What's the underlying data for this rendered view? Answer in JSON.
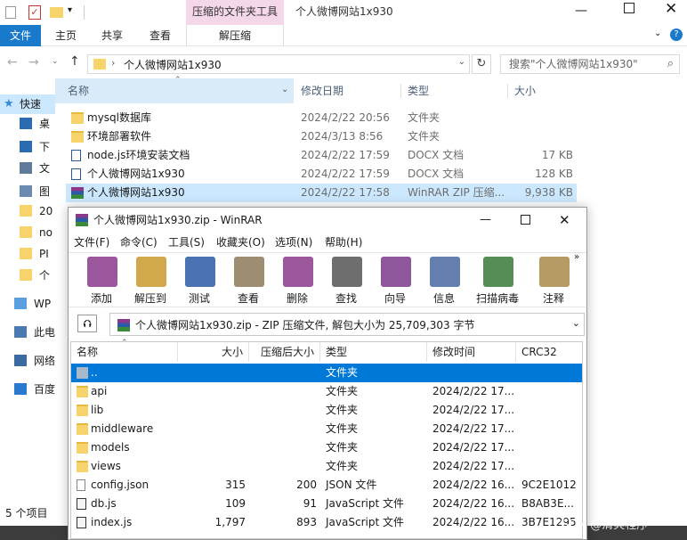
{
  "explorer": {
    "context_tab": "压缩的文件夹工具",
    "window_title": "个人微博网站1x930",
    "ribbon_tabs": [
      "文件",
      "主页",
      "共享",
      "查看",
      "解压缩"
    ],
    "address": "个人微博网站1x930",
    "search_placeholder": "搜索\"个人微博网站1x930\"",
    "columns": [
      "名称",
      "修改日期",
      "类型",
      "大小"
    ],
    "files": [
      {
        "name": "mysql数据库",
        "date": "2024/2/22 20:56",
        "type": "文件夹",
        "size": "",
        "icon": "folder-icon"
      },
      {
        "name": "环境部署软件",
        "date": "2024/3/13 8:56",
        "type": "文件夹",
        "size": "",
        "icon": "folder-icon"
      },
      {
        "name": "node.js环境安装文档",
        "date": "2024/2/22 17:59",
        "type": "DOCX 文档",
        "size": "17 KB",
        "icon": "docx-icon"
      },
      {
        "name": "个人微博网站1x930",
        "date": "2024/2/22 17:59",
        "type": "DOCX 文档",
        "size": "128 KB",
        "icon": "docx-icon"
      },
      {
        "name": "个人微博网站1x930",
        "date": "2024/2/22 17:58",
        "type": "WinRAR ZIP 压缩...",
        "size": "9,938 KB",
        "icon": "winrar-icon"
      }
    ],
    "sidebar": [
      {
        "label": "快速",
        "icon": "star-icon"
      },
      {
        "label": "桌",
        "icon": "desktop-icon"
      },
      {
        "label": "下",
        "icon": "download-icon"
      },
      {
        "label": "文",
        "icon": "document-icon"
      },
      {
        "label": "图",
        "icon": "picture-icon"
      },
      {
        "label": "20",
        "icon": "folder-icon"
      },
      {
        "label": "no",
        "icon": "folder-icon"
      },
      {
        "label": "PI",
        "icon": "folder-icon"
      },
      {
        "label": "个",
        "icon": "folder-icon"
      },
      {
        "label": "WP",
        "icon": "cloud-icon"
      },
      {
        "label": "此电",
        "icon": "pc-icon"
      },
      {
        "label": "网络",
        "icon": "network-icon"
      },
      {
        "label": "百度",
        "icon": "baidu-icon"
      }
    ],
    "status": "5 个项目"
  },
  "winrar": {
    "title": "个人微博网站1x930.zip - WinRAR",
    "menu": [
      "文件(F)",
      "命令(C)",
      "工具(S)",
      "收藏夹(O)",
      "选项(N)",
      "帮助(H)"
    ],
    "tools": [
      {
        "label": "添加",
        "icon": "add-archive-icon",
        "color": "#8b3a8b"
      },
      {
        "label": "解压到",
        "icon": "extract-icon",
        "color": "#c99a2e"
      },
      {
        "label": "测试",
        "icon": "test-icon",
        "color": "#2b5aa6"
      },
      {
        "label": "查看",
        "icon": "view-icon",
        "color": "#8a7a5a"
      },
      {
        "label": "删除",
        "icon": "delete-icon",
        "color": "#8b3a8b"
      },
      {
        "label": "查找",
        "icon": "find-icon",
        "color": "#555555"
      },
      {
        "label": "向导",
        "icon": "wizard-icon",
        "color": "#7a3a8b"
      },
      {
        "label": "信息",
        "icon": "info-icon",
        "color": "#4a6aa0"
      },
      {
        "label": "扫描病毒",
        "icon": "virus-scan-icon",
        "color": "#3a7a3a"
      },
      {
        "label": "注释",
        "icon": "comment-icon",
        "color": "#aa8a4a"
      }
    ],
    "path": "个人微博网站1x930.zip - ZIP 压缩文件, 解包大小为 25,709,303 字节",
    "columns": [
      "名称",
      "大小",
      "压缩后大小",
      "类型",
      "修改时间",
      "CRC32"
    ],
    "rows": [
      {
        "name": "..",
        "size": "",
        "packed": "",
        "type": "文件夹",
        "mtime": "",
        "crc": "",
        "icon": "up-folder-icon",
        "selected": true
      },
      {
        "name": "api",
        "size": "",
        "packed": "",
        "type": "文件夹",
        "mtime": "2024/2/22 17...",
        "crc": "",
        "icon": "folder-icon"
      },
      {
        "name": "lib",
        "size": "",
        "packed": "",
        "type": "文件夹",
        "mtime": "2024/2/22 17...",
        "crc": "",
        "icon": "folder-icon"
      },
      {
        "name": "middleware",
        "size": "",
        "packed": "",
        "type": "文件夹",
        "mtime": "2024/2/22 17...",
        "crc": "",
        "icon": "folder-icon"
      },
      {
        "name": "models",
        "size": "",
        "packed": "",
        "type": "文件夹",
        "mtime": "2024/2/22 17...",
        "crc": "",
        "icon": "folder-icon"
      },
      {
        "name": "views",
        "size": "",
        "packed": "",
        "type": "文件夹",
        "mtime": "2024/2/22 17...",
        "crc": "",
        "icon": "folder-icon"
      },
      {
        "name": "config.json",
        "size": "315",
        "packed": "200",
        "type": "JSON 文件",
        "mtime": "2024/2/22 16...",
        "crc": "9C2E1012",
        "icon": "json-file-icon"
      },
      {
        "name": "db.js",
        "size": "109",
        "packed": "91",
        "type": "JavaScript 文件",
        "mtime": "2024/2/22 16...",
        "crc": "B8AB3E...",
        "icon": "js-file-icon"
      },
      {
        "name": "index.js",
        "size": "1,797",
        "packed": "893",
        "type": "JavaScript 文件",
        "mtime": "2024/2/22 16...",
        "crc": "3B7E1295",
        "icon": "js-file-icon"
      }
    ]
  },
  "watermark": "CSDN @清爽程序",
  "colors": {
    "accent": "#0078d7",
    "context_tab_bg": "#f5d7ea",
    "selection": "#cce8ff"
  }
}
